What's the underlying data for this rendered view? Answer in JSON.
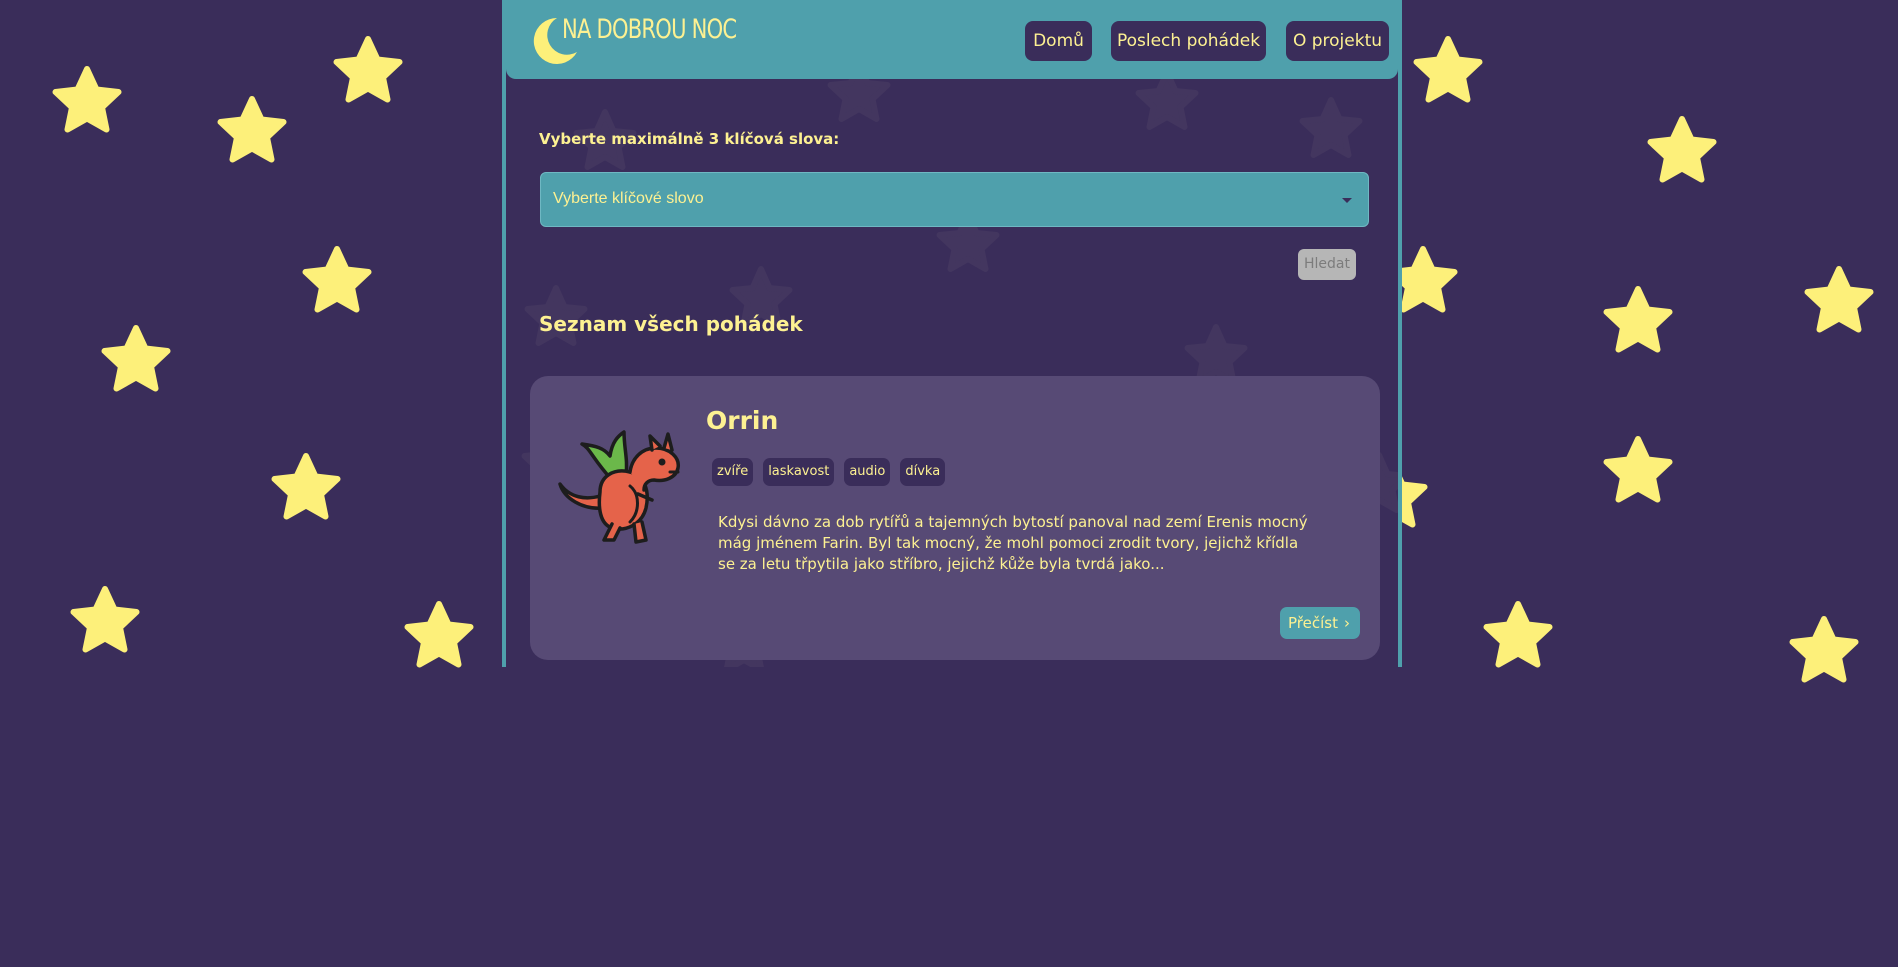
{
  "brand": {
    "name": "NA DOBROU NOC",
    "logo_icon": "moon-icon"
  },
  "nav": {
    "items": [
      {
        "label": "Domů"
      },
      {
        "label": "Poslech pohádek"
      },
      {
        "label": "O projektu"
      }
    ]
  },
  "filter": {
    "label": "Vyberte maximálně 3 klíčová slova:",
    "select_value": "Vyberte klíčové slovo",
    "search_label": "Hledat"
  },
  "list": {
    "title": "Seznam všech pohádek",
    "stories": [
      {
        "title": "Orrin",
        "image_icon": "dragon-icon",
        "tags": [
          "zvíře",
          "laskavost",
          "audio",
          "dívka"
        ],
        "excerpt": "Kdysi dávno za dob rytířů a tajemných bytostí panoval nad zemí Erenis mocný mág jménem Farin. Byl tak mocný, že mohl pomoci zrodit tvory, jejichž křídla se za letu třpytila jako stříbro, jejichž kůže byla tvrdá jako...",
        "read_label": "Přečíst"
      }
    ]
  },
  "colors": {
    "background": "#3a2d5a",
    "accent": "#4fa0ac",
    "text": "#fdf192",
    "star": "#fdf07a",
    "card": "#574a75"
  }
}
